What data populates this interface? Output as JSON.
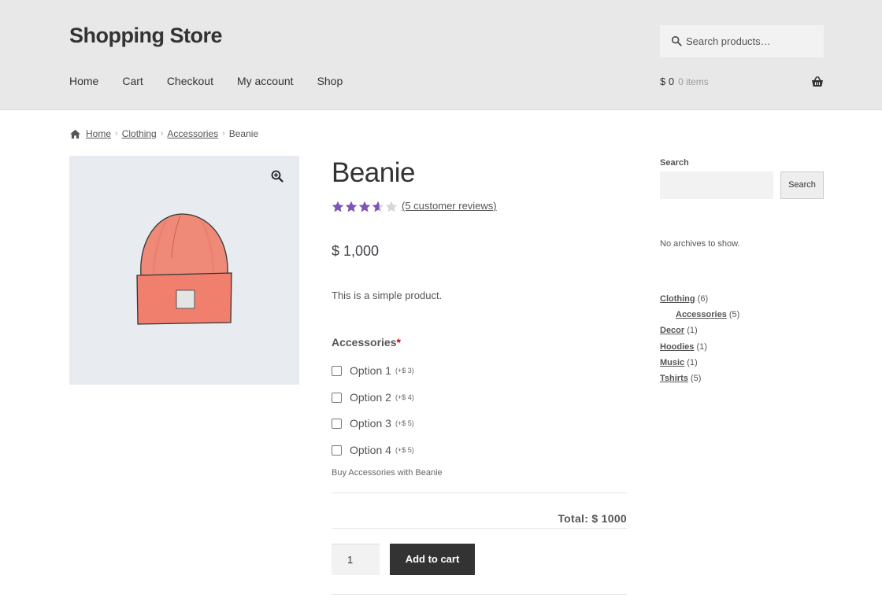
{
  "site": {
    "title": "Shopping Store"
  },
  "search": {
    "placeholder": "Search products…"
  },
  "nav": {
    "items": [
      "Home",
      "Cart",
      "Checkout",
      "My account",
      "Shop"
    ]
  },
  "cart_mini": {
    "amount": "$ 0",
    "items": "0 items"
  },
  "breadcrumb": {
    "items": [
      "Home",
      "Clothing",
      "Accessories"
    ],
    "current": "Beanie"
  },
  "product": {
    "title": "Beanie",
    "rating": 3.6,
    "rating_max": 5,
    "reviews_label": "(5 customer reviews)",
    "price": "$ 1,000",
    "description": "This is a simple product.",
    "accessories_label": "Accessories",
    "required_mark": "*",
    "options": [
      {
        "label": "Option 1",
        "add": "(+$ 3)"
      },
      {
        "label": "Option 2",
        "add": "(+$ 4)"
      },
      {
        "label": "Option 3",
        "add": "(+$ 5)"
      },
      {
        "label": "Option 4",
        "add": "(+$ 5)"
      }
    ],
    "buy_with": "Buy Accessories with Beanie",
    "total": "Total: $ 1000",
    "quantity": "1",
    "add_to_cart": "Add to cart"
  },
  "sidebar": {
    "search_label": "Search",
    "search_button": "Search",
    "no_archives": "No archives to show.",
    "categories": [
      {
        "name": "Clothing",
        "count": "(6)",
        "child": false
      },
      {
        "name": "Accessories",
        "count": "(5)",
        "child": true
      },
      {
        "name": "Decor",
        "count": "(1)",
        "child": false
      },
      {
        "name": "Hoodies",
        "count": "(1)",
        "child": false
      },
      {
        "name": "Music",
        "count": "(1)",
        "child": false
      },
      {
        "name": "Tshirts",
        "count": "(5)",
        "child": false
      }
    ]
  },
  "colors": {
    "header_bg": "#e8e8e8",
    "star": "#7f54b3",
    "button": "#333333"
  }
}
